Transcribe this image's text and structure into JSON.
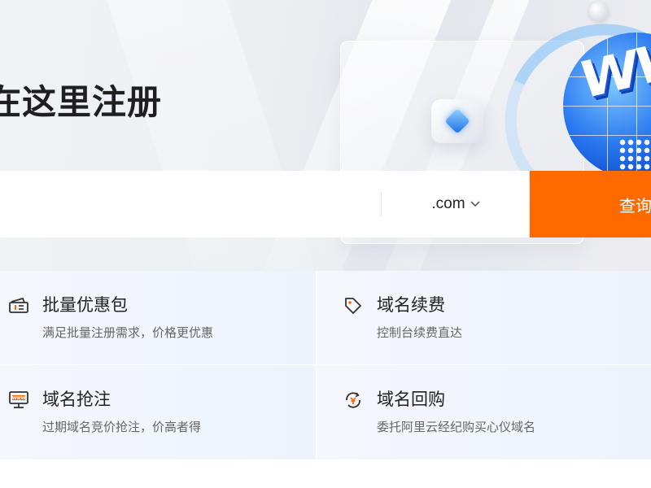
{
  "hero": {
    "title": "在这里注册",
    "illustration_text": "WWW"
  },
  "search": {
    "input_value": "",
    "input_placeholder": "",
    "suffix_selected": ".com",
    "button_label": "查询"
  },
  "services": [
    {
      "icon": "coupon-ticket-icon",
      "title": "批量优惠包",
      "desc": "满足批量注册需求，价格更优惠"
    },
    {
      "icon": "price-tag-icon",
      "title": "域名续费",
      "desc": "控制台续费直达"
    },
    {
      "icon": "www-monitor-icon",
      "title": "域名抢注",
      "desc": "过期域名竞价抢注，价高者得"
    },
    {
      "icon": "yuan-refresh-icon",
      "title": "域名回购",
      "desc": "委托阿里云经纪购买心仪域名"
    }
  ],
  "colors": {
    "accent": "#ff6a00",
    "text_primary": "#222222",
    "text_secondary": "#666666",
    "card_bg": "#f3f6fb"
  }
}
